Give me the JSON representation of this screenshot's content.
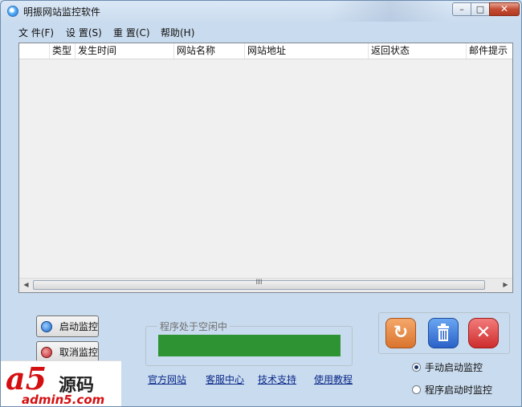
{
  "window": {
    "title": "明振网站监控软件",
    "controls": {
      "minimize": "–",
      "maximize": "□",
      "close": "✕"
    }
  },
  "menu": [
    {
      "label": "文 件(F)"
    },
    {
      "label": "设 置(S)"
    },
    {
      "label": "重 置(C)"
    },
    {
      "label": "帮助(H)"
    }
  ],
  "table": {
    "columns": [
      "",
      "类型",
      "发生时间",
      "网站名称",
      "网站地址",
      "返回状态",
      "邮件提示"
    ],
    "rows": []
  },
  "scrollbar": {
    "grip": "III"
  },
  "buttons": {
    "start": "启动监控",
    "cancel": "取消监控"
  },
  "status": {
    "caption": "程序处于空闲中",
    "progress_color": "#2e9433"
  },
  "links": [
    "官方网站",
    "客服中心",
    "技术支持",
    "使用教程"
  ],
  "icons": {
    "refresh": "refresh-icon",
    "delete": "trash-icon",
    "close": "close-icon"
  },
  "radios": [
    {
      "label": "手动启动监控",
      "checked": true
    },
    {
      "label": "程序启动时监控",
      "checked": false
    }
  ],
  "watermark": {
    "logo": "a5",
    "brand": "源码",
    "domain": "admin5.com"
  }
}
